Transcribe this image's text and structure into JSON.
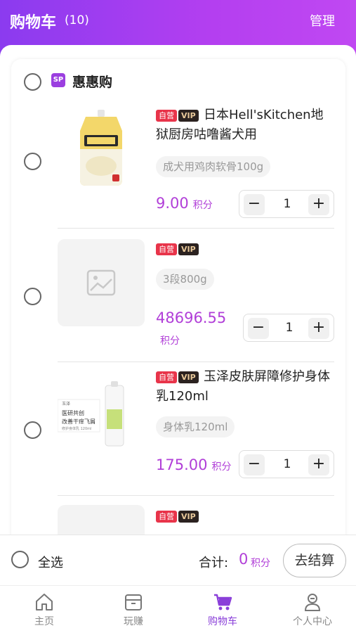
{
  "header": {
    "title": "购物车",
    "count": "(10)",
    "manage_label": "管理"
  },
  "shop": {
    "logo_text": "SP",
    "name": "惠惠购"
  },
  "items": [
    {
      "tag_self": "自营",
      "tag_vip": "VIP",
      "title": "日本Hell'sKitchen地狱厨房咕噜酱犬用",
      "spec": "成犬用鸡肉软骨100g",
      "price": "9.00",
      "unit": "积分",
      "qty": "1",
      "thumb": "pouch-image"
    },
    {
      "tag_self": "自营",
      "tag_vip": "VIP",
      "title": "",
      "spec": "3段800g",
      "price": "48696.55",
      "unit": "积分",
      "qty": "1",
      "thumb": "image-placeholder-icon"
    },
    {
      "tag_self": "自营",
      "tag_vip": "VIP",
      "title": "玉泽皮肤屏障修护身体乳120ml",
      "spec": "身体乳120ml",
      "price": "175.00",
      "unit": "积分",
      "qty": "1",
      "thumb": "lotion-image",
      "box_text_1": "医研共创",
      "box_text_2": "改善干痒飞屑",
      "box_text_3": "修护身体乳 120ml",
      "brand_text": "玉泽"
    },
    {
      "tag_self": "自营",
      "tag_vip": "VIP"
    }
  ],
  "footer": {
    "select_all": "全选",
    "total_label": "合计:",
    "total_value": "0",
    "total_unit": "积分",
    "checkout": "去结算"
  },
  "tabs": [
    {
      "label": "主页",
      "icon": "home-icon"
    },
    {
      "label": "玩赚",
      "icon": "box-icon"
    },
    {
      "label": "购物车",
      "icon": "cart-icon"
    },
    {
      "label": "个人中心",
      "icon": "user-icon"
    }
  ],
  "colors": {
    "accent": "#b13fd8",
    "header_start": "#8b3bef",
    "header_end": "#c048f2",
    "tag_self": "#e8344a",
    "tag_vip": "#2b2220"
  }
}
